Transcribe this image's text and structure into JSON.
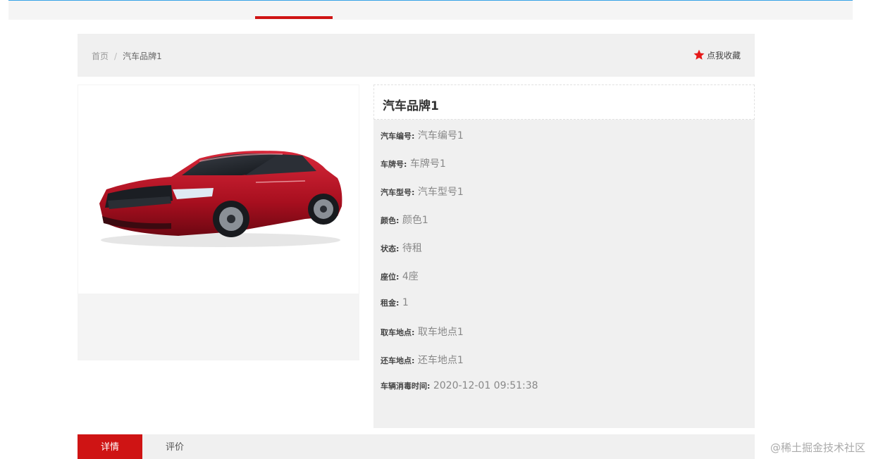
{
  "breadcrumb": {
    "home": "首页",
    "separator": "/",
    "current": "汽车品牌1"
  },
  "favorite": {
    "label": "点我收藏",
    "icon": "star-icon",
    "icon_color": "#e61919"
  },
  "product": {
    "image": "red-sedan-photo",
    "title": "汽车品牌1",
    "fields": [
      {
        "label": "汽车编号:",
        "value": "汽车编号1"
      },
      {
        "label": "车牌号:",
        "value": "车牌号1"
      },
      {
        "label": "汽车型号:",
        "value": "汽车型号1"
      },
      {
        "label": "颜色:",
        "value": "颜色1"
      },
      {
        "label": "状态:",
        "value": "待租"
      },
      {
        "label": "座位:",
        "value": "4座"
      },
      {
        "label": "租金:",
        "value": "1"
      },
      {
        "label": "取车地点:",
        "value": "取车地点1"
      },
      {
        "label": "还车地点:",
        "value": "还车地点1"
      },
      {
        "label": "车辆消毒时间:",
        "value": "2020-12-01 09:51:38"
      }
    ]
  },
  "tabs": [
    {
      "label": "详情",
      "active": true
    },
    {
      "label": "评价",
      "active": false
    }
  ],
  "watermark": "@稀土掘金技术社区",
  "colors": {
    "accent": "#cf1414",
    "top_line": "#37a3e6"
  }
}
